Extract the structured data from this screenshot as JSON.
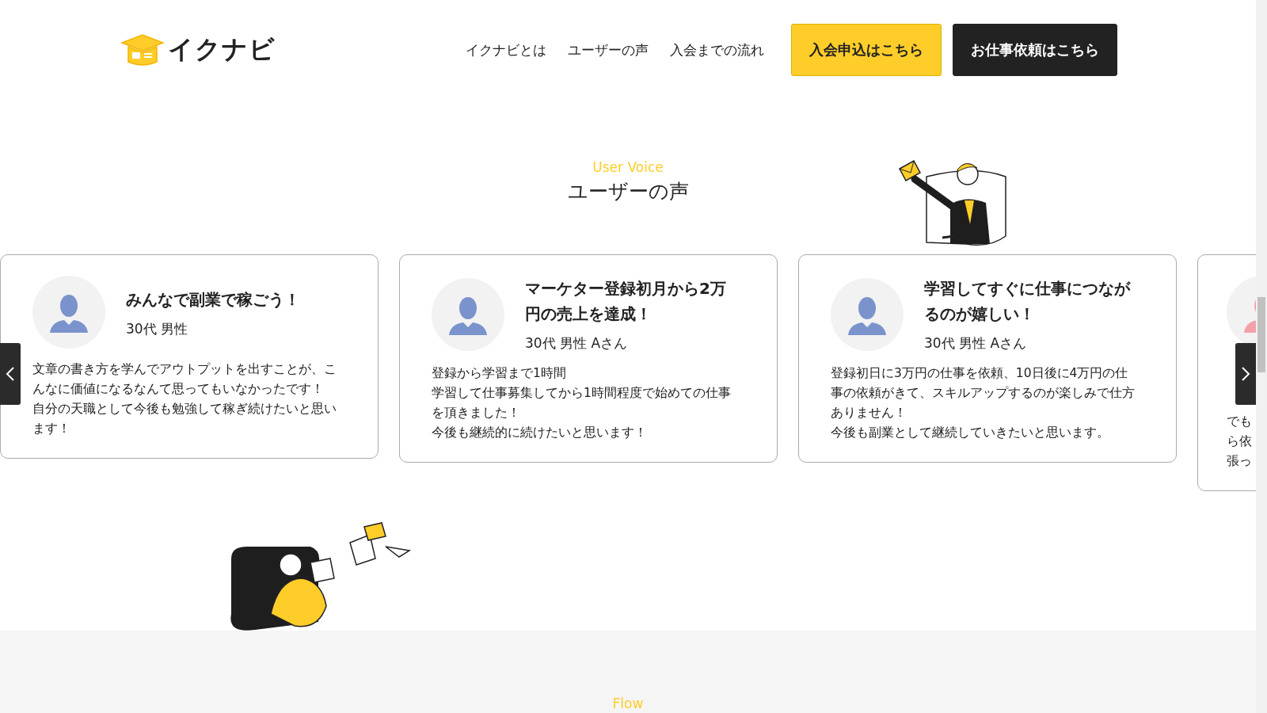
{
  "header": {
    "logo_text": "イクナビ",
    "nav": [
      "イクナビとは",
      "ユーザーの声",
      "入会までの流れ"
    ],
    "buttons": [
      {
        "label": "入会申込はこちら",
        "kind": "primary"
      },
      {
        "label": "お仕事依頼はこちら",
        "kind": "dark"
      }
    ]
  },
  "voice": {
    "eyebrow": "User Voice",
    "title": "ユーザーの声",
    "testimonials": [
      {
        "title": "みんなで副業で稼ごう！",
        "meta": "30代 男性",
        "body": [
          "文章の書き方を学んでアウトプットを出すことが、こんなに価値になるなんて思ってもいなかったです！",
          "自分の天職として今後も勉強して稼ぎ続けたいと思います！"
        ],
        "color": "#7b93cc"
      },
      {
        "title": "マーケター登録初月から2万円の売上を達成！",
        "meta": "30代 男性 Aさん",
        "body": [
          "登録から学習まで1時間",
          "学習して仕事募集してから1時間程度で始めての仕事を頂きました！",
          "今後も継続的に続けたいと思います！"
        ],
        "color": "#7b93cc"
      },
      {
        "title": "学習してすぐに仕事につながるのが嬉しい！",
        "meta": "30代 男性 Aさん",
        "body": [
          "登録初日に3万円の仕事を依頼、10日後に4万円の仕事の依頼がきて、スキルアップするのが楽しみで仕方ありません！",
          "今後も副業として継続していきたいと思います。"
        ],
        "color": "#7b93cc"
      },
      {
        "body": [
          "でも",
          "ら依",
          "張っ"
        ],
        "color": "#f4a0a8"
      }
    ]
  },
  "flow": {
    "eyebrow": "Flow"
  }
}
